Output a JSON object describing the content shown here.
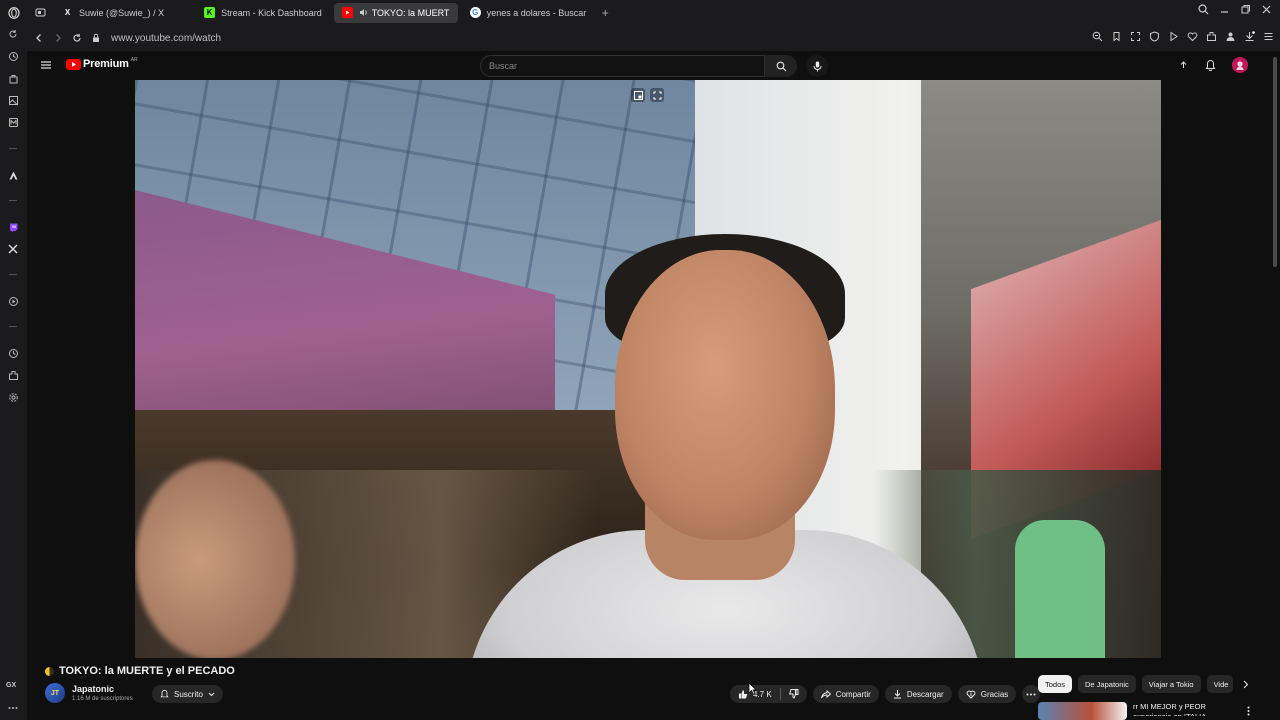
{
  "browser": {
    "tabs": [
      {
        "label": "Suwie (@Suwie_) / X",
        "icon": "x-logo-icon",
        "active": false
      },
      {
        "label": "Stream - Kick Dashboard",
        "icon": "kick-logo-icon",
        "active": false
      },
      {
        "label": "TOKYO: la MUERT",
        "icon": "youtube-logo-icon",
        "active": true
      },
      {
        "label": "yenes a dolares - Buscar",
        "icon": "google-logo-icon",
        "active": false
      }
    ],
    "new_tab": "+",
    "url": "www.youtube.com/watch"
  },
  "sidebar": {
    "bottom_label": "GX"
  },
  "youtube": {
    "brand": "Premium",
    "region": "AR",
    "search_placeholder": "Buscar",
    "video": {
      "title": "TOKYO: la MUERTE y el PECADO"
    },
    "channel": {
      "name": "Japatonic",
      "subscribers": "1.16 M de suscriptores",
      "subscribe_label": "Suscrito"
    },
    "actions": {
      "likes": "4.7 K",
      "share": "Compartir",
      "download": "Descargar",
      "thanks": "Gracias"
    },
    "chips": [
      "Todos",
      "De Japatonic",
      "Viajar a Tokio",
      "Vide"
    ],
    "recommended": {
      "title": "rr MI MEJOR y PEOR experiencia en ITALIA"
    }
  },
  "colors": {
    "background": "#0f0f0f",
    "youtube_red": "#ff0000",
    "browser_chrome": "#1b1b1d"
  }
}
